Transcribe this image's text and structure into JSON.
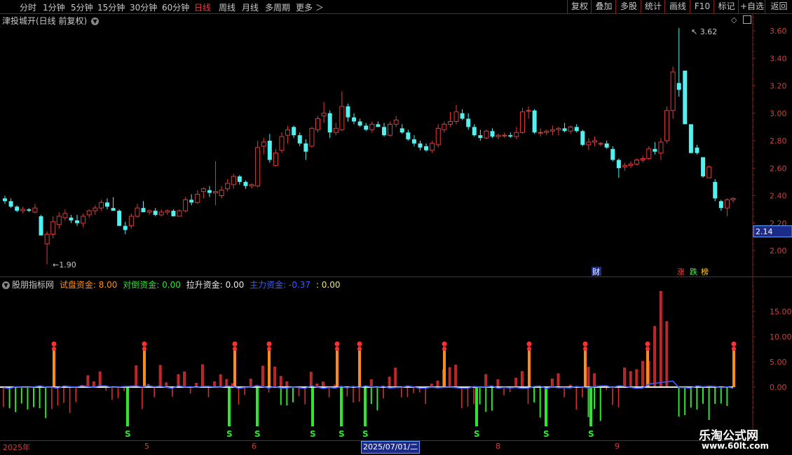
{
  "toolbar": {
    "periods": [
      "分时",
      "1分钟",
      "5分钟",
      "15分钟",
      "30分钟",
      "60分钟",
      "日线",
      "周线",
      "月线",
      "多周期",
      "更多 ＞"
    ],
    "active_period": "日线",
    "right_buttons": [
      "复权",
      "叠加",
      "多股",
      "统计",
      "画线",
      "F10",
      "标记",
      "+自选",
      "返回"
    ]
  },
  "main_panel": {
    "title": "津投城开(日线 前复权)",
    "high_label": "3.62",
    "low_label": "1.90",
    "price_tag": "2.14",
    "y_ticks": [
      "3.60",
      "3.40",
      "3.20",
      "3.00",
      "2.80",
      "2.60",
      "2.40",
      "2.20",
      "2.00"
    ],
    "marker_cai": "财",
    "marker_zhang": "涨",
    "marker_die": "跌",
    "marker_bang": "榜"
  },
  "sub_panel": {
    "name": "股朋指标网",
    "items": [
      {
        "label": "试盘资金:",
        "value": "8.00",
        "color": "#ff8c1a"
      },
      {
        "label": "对倒资金:",
        "value": "0.00",
        "color": "#2ee62e"
      },
      {
        "label": "拉升资金:",
        "value": "0.00",
        "color": "#e8e8e8"
      },
      {
        "label": "主力资金:",
        "value": "-0.37",
        "color": "#3a5bff"
      },
      {
        "label": ":",
        "value": "0.00",
        "color": "#e8e870"
      }
    ],
    "y_ticks": [
      "15.00",
      "10.00",
      "5.00",
      "0.00"
    ],
    "s_label": "S"
  },
  "date_axis": {
    "labels": [
      {
        "text": "2025年"
      },
      {
        "text": "5"
      },
      {
        "text": "6"
      },
      {
        "text": "8"
      },
      {
        "text": "9"
      }
    ],
    "cursor": "2025/07/01/二"
  },
  "watermark": {
    "name": "乐淘公式网",
    "url": "www.60lt.com"
  },
  "colors": {
    "up": "#e03b3b",
    "down": "#54f0f0",
    "bg": "#000000",
    "grid": "#8b1a1a"
  },
  "chart_data": {
    "type": "candlestick",
    "ylim": [
      1.85,
      3.75
    ],
    "candles": [
      [
        2.38,
        2.4,
        2.34,
        2.36
      ],
      [
        2.36,
        2.38,
        2.31,
        2.32
      ],
      [
        2.32,
        2.33,
        2.28,
        2.29
      ],
      [
        2.29,
        2.32,
        2.27,
        2.3
      ],
      [
        2.3,
        2.31,
        2.28,
        2.29
      ],
      [
        2.28,
        2.34,
        2.27,
        2.31
      ],
      [
        2.25,
        2.26,
        2.12,
        2.11
      ],
      [
        2.05,
        2.14,
        1.9,
        2.12
      ],
      [
        2.12,
        2.25,
        2.09,
        2.21
      ],
      [
        2.19,
        2.28,
        2.16,
        2.25
      ],
      [
        2.24,
        2.3,
        2.22,
        2.27
      ],
      [
        2.24,
        2.26,
        2.2,
        2.22
      ],
      [
        2.22,
        2.26,
        2.18,
        2.2
      ],
      [
        2.2,
        2.27,
        2.17,
        2.25
      ],
      [
        2.26,
        2.3,
        2.24,
        2.29
      ],
      [
        2.29,
        2.33,
        2.26,
        2.31
      ],
      [
        2.31,
        2.37,
        2.29,
        2.35
      ],
      [
        2.35,
        2.38,
        2.3,
        2.32
      ],
      [
        2.31,
        2.39,
        2.29,
        2.29
      ],
      [
        2.29,
        2.3,
        2.18,
        2.18
      ],
      [
        2.18,
        2.21,
        2.12,
        2.15
      ],
      [
        2.18,
        2.27,
        2.16,
        2.25
      ],
      [
        2.25,
        2.34,
        2.24,
        2.31
      ],
      [
        2.31,
        2.36,
        2.28,
        2.28
      ],
      [
        2.28,
        2.3,
        2.26,
        2.29
      ],
      [
        2.29,
        2.31,
        2.25,
        2.26
      ],
      [
        2.26,
        2.3,
        2.25,
        2.28
      ],
      [
        2.28,
        2.3,
        2.26,
        2.29
      ],
      [
        2.29,
        2.3,
        2.25,
        2.25
      ],
      [
        2.25,
        2.3,
        2.25,
        2.29
      ],
      [
        2.29,
        2.39,
        2.28,
        2.37
      ],
      [
        2.37,
        2.41,
        2.33,
        2.35
      ],
      [
        2.35,
        2.44,
        2.34,
        2.41
      ],
      [
        2.43,
        2.46,
        2.38,
        2.45
      ],
      [
        2.44,
        2.47,
        2.39,
        2.42
      ],
      [
        2.42,
        2.65,
        2.33,
        2.43
      ],
      [
        2.4,
        2.47,
        2.38,
        2.44
      ],
      [
        2.45,
        2.52,
        2.43,
        2.49
      ],
      [
        2.48,
        2.56,
        2.45,
        2.54
      ],
      [
        2.54,
        2.55,
        2.48,
        2.5
      ],
      [
        2.5,
        2.51,
        2.45,
        2.47
      ],
      [
        2.47,
        2.49,
        2.45,
        2.48
      ],
      [
        2.47,
        2.8,
        2.46,
        2.75
      ],
      [
        2.76,
        2.82,
        2.7,
        2.79
      ],
      [
        2.8,
        2.85,
        2.64,
        2.66
      ],
      [
        2.62,
        2.74,
        2.61,
        2.71
      ],
      [
        2.73,
        2.86,
        2.71,
        2.83
      ],
      [
        2.84,
        2.91,
        2.78,
        2.88
      ],
      [
        2.9,
        2.91,
        2.82,
        2.84
      ],
      [
        2.84,
        2.86,
        2.76,
        2.78
      ],
      [
        2.78,
        2.81,
        2.66,
        2.72
      ],
      [
        2.76,
        2.9,
        2.75,
        2.89
      ],
      [
        2.88,
        2.98,
        2.86,
        2.96
      ],
      [
        2.98,
        3.08,
        2.93,
        3.0
      ],
      [
        3.0,
        3.02,
        2.82,
        2.86
      ],
      [
        2.86,
        2.93,
        2.84,
        2.89
      ],
      [
        2.88,
        3.16,
        2.87,
        3.05
      ],
      [
        3.05,
        3.07,
        2.94,
        2.97
      ],
      [
        2.97,
        3.0,
        2.92,
        2.94
      ],
      [
        2.94,
        2.96,
        2.9,
        2.91
      ],
      [
        2.91,
        2.93,
        2.87,
        2.88
      ],
      [
        2.88,
        2.94,
        2.86,
        2.92
      ],
      [
        2.92,
        2.94,
        2.9,
        2.9
      ],
      [
        2.9,
        2.93,
        2.83,
        2.84
      ],
      [
        2.84,
        2.94,
        2.83,
        2.92
      ],
      [
        2.92,
        2.98,
        2.9,
        2.95
      ],
      [
        2.89,
        2.92,
        2.85,
        2.86
      ],
      [
        2.86,
        2.88,
        2.8,
        2.81
      ],
      [
        2.81,
        2.84,
        2.76,
        2.78
      ],
      [
        2.78,
        2.8,
        2.73,
        2.75
      ],
      [
        2.76,
        2.78,
        2.72,
        2.73
      ],
      [
        2.73,
        2.8,
        2.71,
        2.78
      ],
      [
        2.77,
        2.92,
        2.75,
        2.89
      ],
      [
        2.88,
        2.94,
        2.86,
        2.92
      ],
      [
        2.92,
        3.01,
        2.9,
        2.94
      ],
      [
        2.94,
        3.06,
        2.92,
        3.01
      ],
      [
        3.0,
        3.03,
        2.95,
        2.96
      ],
      [
        2.96,
        3.0,
        2.88,
        2.9
      ],
      [
        2.9,
        2.92,
        2.83,
        2.84
      ],
      [
        2.84,
        2.88,
        2.8,
        2.82
      ],
      [
        2.82,
        2.88,
        2.81,
        2.87
      ],
      [
        2.87,
        2.89,
        2.82,
        2.83
      ],
      [
        2.83,
        2.85,
        2.81,
        2.84
      ],
      [
        2.84,
        2.86,
        2.82,
        2.84
      ],
      [
        2.84,
        2.86,
        2.82,
        2.83
      ],
      [
        2.83,
        2.9,
        2.81,
        2.86
      ],
      [
        2.86,
        3.04,
        2.85,
        3.01
      ],
      [
        3.02,
        3.05,
        2.96,
        3.02
      ],
      [
        3.02,
        3.03,
        2.85,
        2.86
      ],
      [
        2.86,
        2.89,
        2.83,
        2.86
      ],
      [
        2.86,
        2.88,
        2.84,
        2.87
      ],
      [
        2.87,
        2.91,
        2.84,
        2.88
      ],
      [
        2.88,
        2.9,
        2.84,
        2.89
      ],
      [
        2.89,
        2.93,
        2.86,
        2.87
      ],
      [
        2.87,
        2.91,
        2.85,
        2.9
      ],
      [
        2.9,
        2.92,
        2.86,
        2.87
      ],
      [
        2.87,
        2.88,
        2.76,
        2.77
      ],
      [
        2.77,
        2.82,
        2.73,
        2.79
      ],
      [
        2.79,
        2.83,
        2.76,
        2.8
      ],
      [
        2.78,
        2.79,
        2.76,
        2.78
      ],
      [
        2.78,
        2.8,
        2.74,
        2.75
      ],
      [
        2.74,
        2.76,
        2.65,
        2.66
      ],
      [
        2.66,
        2.67,
        2.53,
        2.6
      ],
      [
        2.61,
        2.64,
        2.58,
        2.62
      ],
      [
        2.62,
        2.65,
        2.6,
        2.63
      ],
      [
        2.63,
        2.67,
        2.62,
        2.66
      ],
      [
        2.66,
        2.69,
        2.64,
        2.67
      ],
      [
        2.67,
        2.76,
        2.66,
        2.74
      ],
      [
        2.74,
        2.79,
        2.7,
        2.72
      ],
      [
        2.71,
        2.82,
        2.66,
        2.79
      ],
      [
        2.8,
        3.05,
        2.78,
        3.02
      ],
      [
        3.02,
        3.34,
        2.96,
        3.3
      ],
      [
        3.22,
        3.62,
        3.12,
        3.17
      ],
      [
        3.31,
        3.31,
        2.92,
        2.92
      ],
      [
        2.92,
        2.91,
        2.71,
        2.71
      ],
      [
        2.75,
        2.77,
        2.7,
        2.71
      ],
      [
        2.68,
        2.68,
        2.53,
        2.54
      ],
      [
        2.53,
        2.62,
        2.53,
        2.61
      ],
      [
        2.5,
        2.52,
        2.36,
        2.38
      ],
      [
        2.36,
        2.37,
        2.29,
        2.31
      ],
      [
        2.31,
        2.38,
        2.25,
        2.37
      ],
      [
        2.37,
        2.39,
        2.35,
        2.38
      ]
    ],
    "indicator_series": {
      "试盘资金": "orange columns with flag markers",
      "对倒资金": "green negative columns",
      "拉升资金": "red positive columns",
      "主力资金": "blue line"
    }
  }
}
